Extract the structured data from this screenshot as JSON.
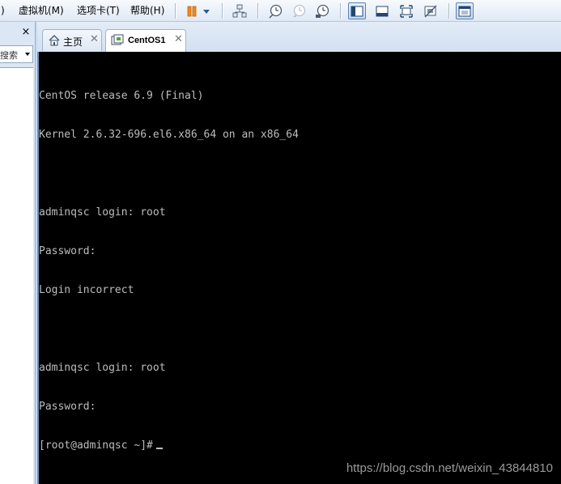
{
  "menu": {
    "items": [
      {
        "label": ")"
      },
      {
        "label": "虚拟机(M)"
      },
      {
        "label": "选项卡(T)"
      },
      {
        "label": "帮助(H)"
      }
    ]
  },
  "toolbar": {
    "buttons": [
      {
        "icon": "pause-icon"
      },
      {
        "icon": "dropdown-arrow-icon"
      },
      {
        "icon": "network-icon"
      },
      {
        "icon": "snapshot-take-icon"
      },
      {
        "icon": "snapshot-revert-icon"
      },
      {
        "icon": "snapshot-manager-icon"
      },
      {
        "icon": "show-library-icon",
        "active": true
      },
      {
        "icon": "show-thumbnail-bar-icon"
      },
      {
        "icon": "fullscreen-icon"
      },
      {
        "icon": "unity-icon"
      },
      {
        "icon": "console-view-icon"
      }
    ]
  },
  "library": {
    "close_glyph": "×",
    "search_text": "搜索"
  },
  "tabs": [
    {
      "label": "主页",
      "icon": "home-icon",
      "active": false
    },
    {
      "label": "CentOS1",
      "icon": "vm-icon",
      "active": true
    }
  ],
  "console": {
    "lines": [
      "CentOS release 6.9 (Final)",
      "Kernel 2.6.32-696.el6.x86_64 on an x86_64",
      "",
      "adminqsc login: root",
      "Password:",
      "Login incorrect",
      "",
      "adminqsc login: root",
      "Password:",
      "[root@adminqsc ~]#"
    ],
    "watermark": "https://blog.csdn.net/weixin_43844810"
  },
  "colors": {
    "console_bg": "#000000",
    "console_text": "#bdbdbd",
    "chrome_bg": "#dce7f5"
  }
}
